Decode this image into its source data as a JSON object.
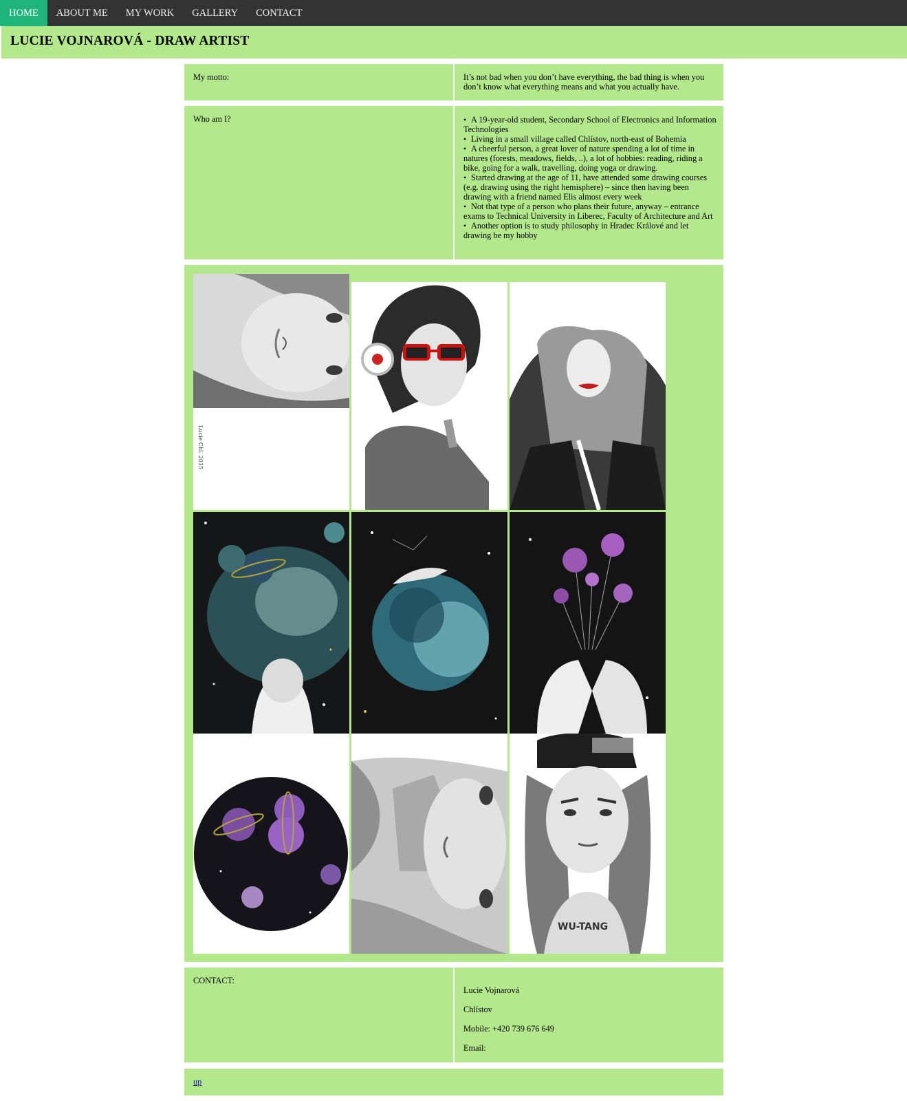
{
  "nav": {
    "items": [
      "HOME",
      "ABOUT ME",
      "MY WORK",
      "GALLERY",
      "CONTACT"
    ],
    "active": "HOME",
    "colors": {
      "bar": "#333333",
      "active": "#1fb57a"
    }
  },
  "header": {
    "title": "LUCIE VOJNAROVÁ - DRAW ARTIST"
  },
  "motto": {
    "label": "My motto:",
    "text": "It’s not bad when you don’t have everything, the bad thing is when you don’t know what everything means and what you actually have."
  },
  "about": {
    "label": "Who am I?",
    "items": [
      "A 19-year-old student, Secondary School of Electronics and Information Technologies",
      "Living in a small village called Chlístov, north-east of Bohemia",
      "A cheerful person, a great lover of nature spending a lot of time in natures (forests, meadows, fields, ..), a lot of hobbies: reading, riding a bike, going for a walk, travelling, doing yoga or drawing.",
      "Started drawing at the age of 11, have attended some drawing courses (e.g. drawing using the right hemisphere) – since then having been drawing with a friend named Elis almost every week",
      "Not that type of a person who plans their future, anyway – entrance exams to Technical University in Liberec, Faculty of Architecture and Art",
      "Another option is to study philosophy in Hradec Králové and let drawing be my hobby"
    ]
  },
  "gallery": {
    "images": [
      {
        "subject": "pencil portrait of a girl, rotated"
      },
      {
        "subject": "girl with red sunglasses and headphones"
      },
      {
        "subject": "woman with hand in hair, red lips"
      },
      {
        "subject": "girl facing galaxy with planets"
      },
      {
        "subject": "figure lying on blue planet"
      },
      {
        "subject": "hands holding purple planet balloons"
      },
      {
        "subject": "circle of purple planets and stars"
      },
      {
        "subject": "pencil face, rotated"
      },
      {
        "subject": "girl in cap with WU-TANG shirt",
        "shirt_text": "WU-TANG"
      }
    ],
    "signature": "Lucie Chl. 2015"
  },
  "contact": {
    "label": "CONTACT:",
    "name": "Lucie Vojnarová",
    "town": "Chlístov",
    "mobile": "Mobile: +420 739 676 649",
    "email": "Email:"
  },
  "footer": {
    "up": "up"
  },
  "colors": {
    "panel": "#b4e88c",
    "page": "#ffffff"
  }
}
